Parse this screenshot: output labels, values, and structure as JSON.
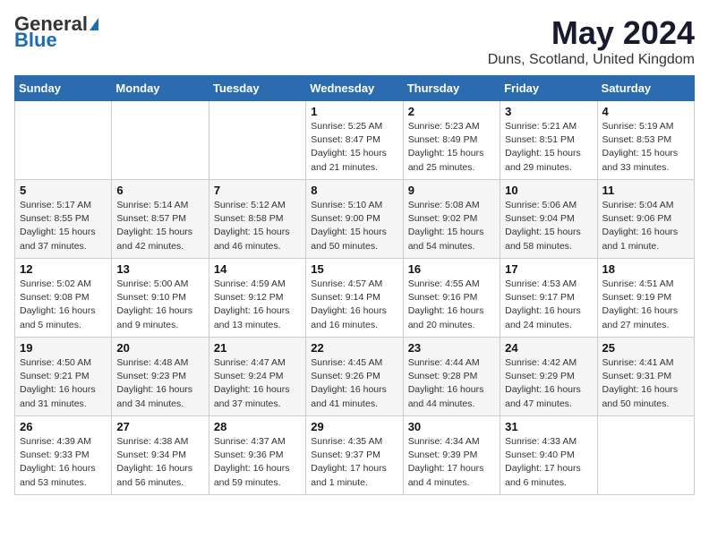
{
  "header": {
    "logo_general": "General",
    "logo_blue": "Blue",
    "month": "May 2024",
    "location": "Duns, Scotland, United Kingdom"
  },
  "weekdays": [
    "Sunday",
    "Monday",
    "Tuesday",
    "Wednesday",
    "Thursday",
    "Friday",
    "Saturday"
  ],
  "weeks": [
    [
      {
        "day": "",
        "info": ""
      },
      {
        "day": "",
        "info": ""
      },
      {
        "day": "",
        "info": ""
      },
      {
        "day": "1",
        "info": "Sunrise: 5:25 AM\nSunset: 8:47 PM\nDaylight: 15 hours\nand 21 minutes."
      },
      {
        "day": "2",
        "info": "Sunrise: 5:23 AM\nSunset: 8:49 PM\nDaylight: 15 hours\nand 25 minutes."
      },
      {
        "day": "3",
        "info": "Sunrise: 5:21 AM\nSunset: 8:51 PM\nDaylight: 15 hours\nand 29 minutes."
      },
      {
        "day": "4",
        "info": "Sunrise: 5:19 AM\nSunset: 8:53 PM\nDaylight: 15 hours\nand 33 minutes."
      }
    ],
    [
      {
        "day": "5",
        "info": "Sunrise: 5:17 AM\nSunset: 8:55 PM\nDaylight: 15 hours\nand 37 minutes."
      },
      {
        "day": "6",
        "info": "Sunrise: 5:14 AM\nSunset: 8:57 PM\nDaylight: 15 hours\nand 42 minutes."
      },
      {
        "day": "7",
        "info": "Sunrise: 5:12 AM\nSunset: 8:58 PM\nDaylight: 15 hours\nand 46 minutes."
      },
      {
        "day": "8",
        "info": "Sunrise: 5:10 AM\nSunset: 9:00 PM\nDaylight: 15 hours\nand 50 minutes."
      },
      {
        "day": "9",
        "info": "Sunrise: 5:08 AM\nSunset: 9:02 PM\nDaylight: 15 hours\nand 54 minutes."
      },
      {
        "day": "10",
        "info": "Sunrise: 5:06 AM\nSunset: 9:04 PM\nDaylight: 15 hours\nand 58 minutes."
      },
      {
        "day": "11",
        "info": "Sunrise: 5:04 AM\nSunset: 9:06 PM\nDaylight: 16 hours\nand 1 minute."
      }
    ],
    [
      {
        "day": "12",
        "info": "Sunrise: 5:02 AM\nSunset: 9:08 PM\nDaylight: 16 hours\nand 5 minutes."
      },
      {
        "day": "13",
        "info": "Sunrise: 5:00 AM\nSunset: 9:10 PM\nDaylight: 16 hours\nand 9 minutes."
      },
      {
        "day": "14",
        "info": "Sunrise: 4:59 AM\nSunset: 9:12 PM\nDaylight: 16 hours\nand 13 minutes."
      },
      {
        "day": "15",
        "info": "Sunrise: 4:57 AM\nSunset: 9:14 PM\nDaylight: 16 hours\nand 16 minutes."
      },
      {
        "day": "16",
        "info": "Sunrise: 4:55 AM\nSunset: 9:16 PM\nDaylight: 16 hours\nand 20 minutes."
      },
      {
        "day": "17",
        "info": "Sunrise: 4:53 AM\nSunset: 9:17 PM\nDaylight: 16 hours\nand 24 minutes."
      },
      {
        "day": "18",
        "info": "Sunrise: 4:51 AM\nSunset: 9:19 PM\nDaylight: 16 hours\nand 27 minutes."
      }
    ],
    [
      {
        "day": "19",
        "info": "Sunrise: 4:50 AM\nSunset: 9:21 PM\nDaylight: 16 hours\nand 31 minutes."
      },
      {
        "day": "20",
        "info": "Sunrise: 4:48 AM\nSunset: 9:23 PM\nDaylight: 16 hours\nand 34 minutes."
      },
      {
        "day": "21",
        "info": "Sunrise: 4:47 AM\nSunset: 9:24 PM\nDaylight: 16 hours\nand 37 minutes."
      },
      {
        "day": "22",
        "info": "Sunrise: 4:45 AM\nSunset: 9:26 PM\nDaylight: 16 hours\nand 41 minutes."
      },
      {
        "day": "23",
        "info": "Sunrise: 4:44 AM\nSunset: 9:28 PM\nDaylight: 16 hours\nand 44 minutes."
      },
      {
        "day": "24",
        "info": "Sunrise: 4:42 AM\nSunset: 9:29 PM\nDaylight: 16 hours\nand 47 minutes."
      },
      {
        "day": "25",
        "info": "Sunrise: 4:41 AM\nSunset: 9:31 PM\nDaylight: 16 hours\nand 50 minutes."
      }
    ],
    [
      {
        "day": "26",
        "info": "Sunrise: 4:39 AM\nSunset: 9:33 PM\nDaylight: 16 hours\nand 53 minutes."
      },
      {
        "day": "27",
        "info": "Sunrise: 4:38 AM\nSunset: 9:34 PM\nDaylight: 16 hours\nand 56 minutes."
      },
      {
        "day": "28",
        "info": "Sunrise: 4:37 AM\nSunset: 9:36 PM\nDaylight: 16 hours\nand 59 minutes."
      },
      {
        "day": "29",
        "info": "Sunrise: 4:35 AM\nSunset: 9:37 PM\nDaylight: 17 hours\nand 1 minute."
      },
      {
        "day": "30",
        "info": "Sunrise: 4:34 AM\nSunset: 9:39 PM\nDaylight: 17 hours\nand 4 minutes."
      },
      {
        "day": "31",
        "info": "Sunrise: 4:33 AM\nSunset: 9:40 PM\nDaylight: 17 hours\nand 6 minutes."
      },
      {
        "day": "",
        "info": ""
      }
    ]
  ]
}
